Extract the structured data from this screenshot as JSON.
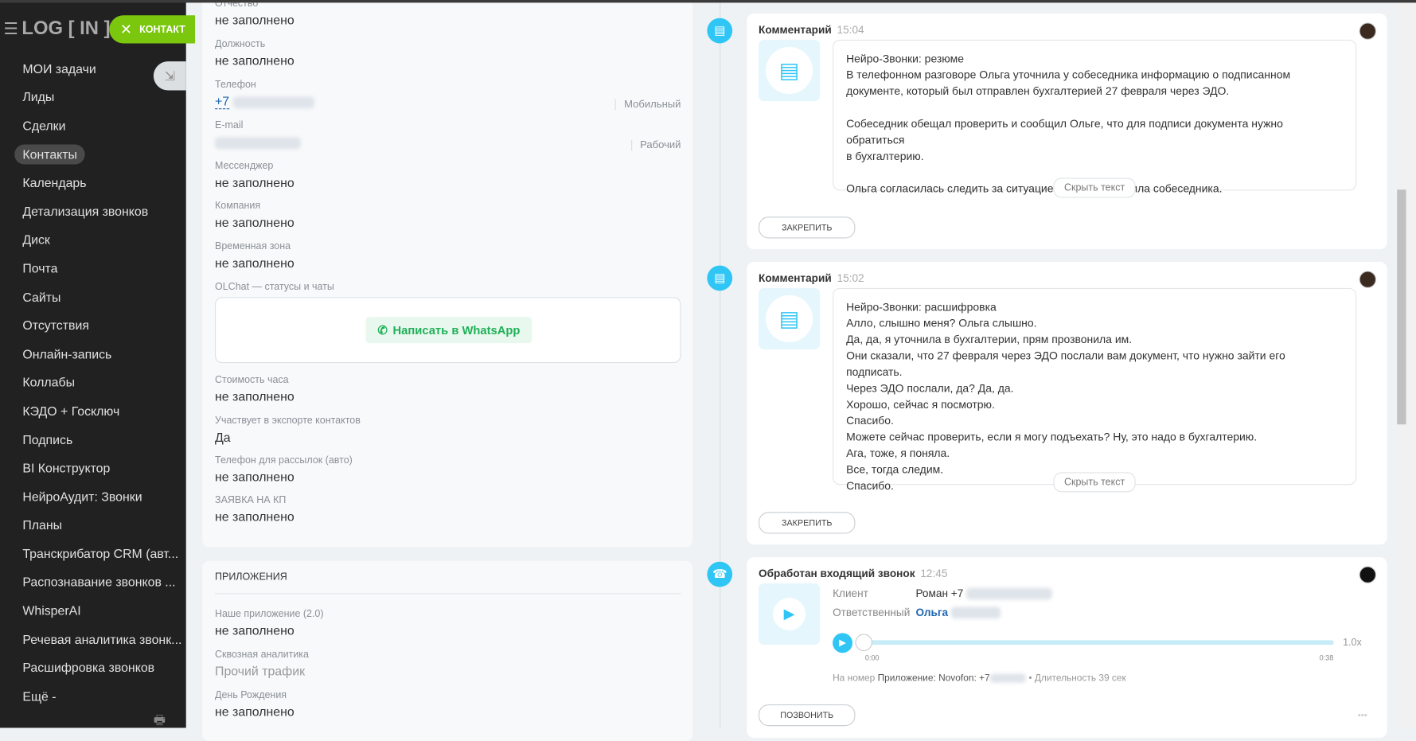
{
  "sidebar": {
    "logo": "LOG [ IN ]",
    "contact_button": "КОНТАКТ",
    "items": [
      "МОИ задачи",
      "Лиды",
      "Сделки",
      "Контакты",
      "Календарь",
      "Детализация звонков",
      "Диск",
      "Почта",
      "Сайты",
      "Отсутствия",
      "Онлайн-запись",
      "Коллабы",
      "КЭДО + Госключ",
      "Подпись",
      "BI Конструктор",
      "НейроАудит: Звонки",
      "Планы",
      "Транскрибатор CRM (авт...",
      "Распознавание звонков ...",
      "WhisperAI",
      "Речевая аналитика звонк...",
      "Расшифровка звонков",
      "Ещё -"
    ],
    "active": "Контакты"
  },
  "contact": {
    "fields": [
      {
        "label": "Отчество",
        "value": "не заполнено"
      },
      {
        "label": "Должность",
        "value": "не заполнено"
      },
      {
        "label": "Телефон",
        "value": "+7",
        "type": "Мобильный"
      },
      {
        "label": "E-mail",
        "value": "",
        "type": "Рабочий"
      },
      {
        "label": "Мессенджер",
        "value": "не заполнено"
      },
      {
        "label": "Компания",
        "value": "не заполнено"
      },
      {
        "label": "Временная зона",
        "value": "не заполнено"
      },
      {
        "label": "OLChat — статусы и чаты",
        "button": "Написать в WhatsApp"
      },
      {
        "label": "Стоимость часа",
        "value": "не заполнено"
      },
      {
        "label": "Участвует в экспорте контактов",
        "value": "Да"
      },
      {
        "label": "Телефон для рассылок (авто)",
        "value": "не заполнено"
      },
      {
        "label": "ЗАЯВКА НА КП",
        "value": "не заполнено"
      }
    ],
    "apps": {
      "title": "ПРИЛОЖЕНИЯ",
      "fields": [
        {
          "label": "Наше приложение (2.0)",
          "value": "не заполнено"
        },
        {
          "label": "Сквозная аналитика",
          "value": "Прочий трафик"
        },
        {
          "label": "День Рождения",
          "value": "не заполнено"
        }
      ]
    }
  },
  "timeline": [
    {
      "title": "Комментарий",
      "time": "15:04",
      "text": "Нейро-Звонки: резюме\nВ телефонном разговоре Ольга уточнила у собеседника информацию о подписанном\nдокументе, который был отправлен бухгалтерией 27 февраля через ЭДО.\n\nСобеседник обещал проверить и сообщил Ольге, что для подписи документа нужно обратиться\nв бухгалтерию.\n\nОльга согласилась следить за ситуацией и поблагодарила собеседника.",
      "hide": "Скрыть текст",
      "pin": "ЗАКРЕПИТЬ"
    },
    {
      "title": "Комментарий",
      "time": "15:02",
      "text": "Нейро-Звонки: расшифровка\nАлло, слышно меня? Ольга слышно.\nДа, да, я уточнила в бухгалтерии, прям прозвонила им.\nОни сказали, что 27 февраля через ЭДО послали вам документ, что нужно зайти его подписать.\nЧерез ЭДО послали, да? Да, да.\nХорошо, сейчас я посмотрю.\nСпасибо.\nМожете сейчас проверить, если я могу подъехать? Ну, это надо в бухгалтерию.\nАга, тоже, я поняла.\nВсе, тогда следим.\nСпасибо.",
      "hide": "Скрыть текст",
      "pin": "ЗАКРЕПИТЬ"
    },
    {
      "title": "Обработан входящий звонок",
      "time": "12:45",
      "client_label": "Клиент",
      "client": "Роман +7",
      "responsible_label": "Ответственный",
      "responsible": "Ольга",
      "start": "0:00",
      "end": "0:38",
      "speed": "1.0x",
      "progress": 0,
      "footer_prefix": "На номер",
      "footer_app": "Приложение: Novofon: +7",
      "footer_duration": "• Длительность 39 сек",
      "call": "ПОЗВОНИТЬ",
      "more": "•••"
    }
  ]
}
